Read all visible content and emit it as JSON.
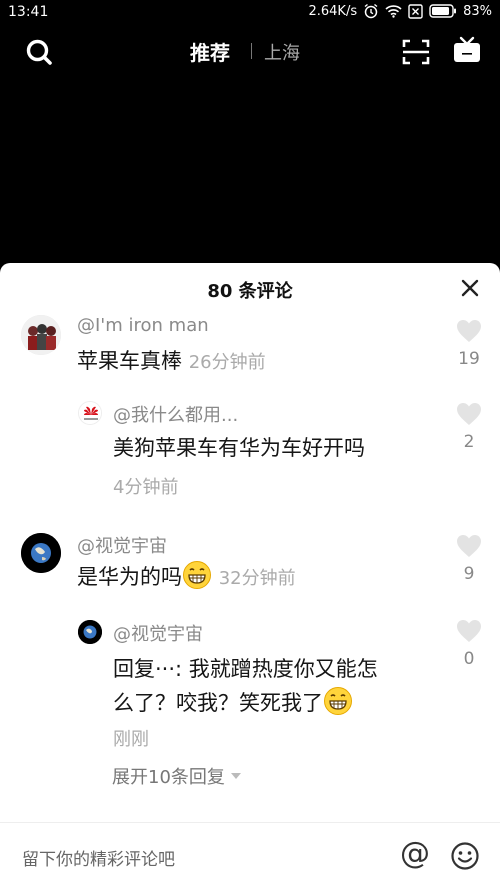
{
  "status": {
    "time": "13:41",
    "speed": "2.64K/s",
    "battery": "83%",
    "icons": [
      "alarm-icon",
      "wifi-icon",
      "sim-icon",
      "battery-icon"
    ]
  },
  "nav": {
    "tab_active": "推荐",
    "tab_city": "上海",
    "icons": [
      "search-icon",
      "scan-icon",
      "tv-icon"
    ]
  },
  "comments_sheet": {
    "title": "80 条评论",
    "comments": [
      {
        "username": "@I'm iron man",
        "text": "苹果车真棒",
        "time": "26分钟前",
        "likes": "19"
      },
      {
        "username": "@我什么都用...",
        "text": "美狗苹果车有华为车好开吗",
        "time": "4分钟前",
        "likes": "2"
      },
      {
        "username": "@视觉宇宙",
        "text": "是华为的吗",
        "time": "32分钟前",
        "likes": "9"
      },
      {
        "username": "@视觉宇宙",
        "text_line1": "回复···: 我就蹭热度你又能怎",
        "text_line2": "么了？咬我？笑死我了",
        "time": "刚刚",
        "likes": "0"
      }
    ],
    "expand_label": "展开10条回复"
  },
  "input": {
    "placeholder": "留下你的精彩评论吧",
    "at_symbol": "@"
  },
  "colors": {
    "background": "#000000",
    "sheet": "#ffffff",
    "secondary_text": "#8a8a8a",
    "like_icon": "#e5e5e5"
  }
}
